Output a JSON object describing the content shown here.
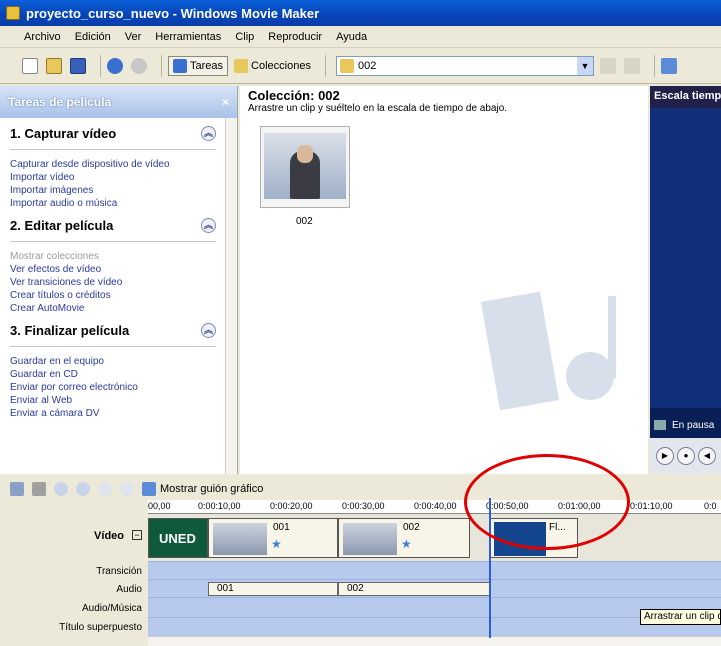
{
  "window": {
    "title": "proyecto_curso_nuevo - Windows Movie Maker"
  },
  "menu": [
    "Archivo",
    "Edición",
    "Ver",
    "Herramientas",
    "Clip",
    "Reproducir",
    "Ayuda"
  ],
  "toolbar": {
    "tasks_label": "Tareas",
    "collections_label": "Colecciones",
    "collection_value": "002"
  },
  "taskpane": {
    "header": "Tareas de película",
    "close": "×",
    "sections": [
      {
        "title": "1. Capturar vídeo",
        "links": [
          "Capturar desde dispositivo de vídeo",
          "Importar vídeo",
          "Importar imágenes",
          "Importar audio o música"
        ]
      },
      {
        "title": "2. Editar película",
        "links": [
          "Mostrar colecciones",
          "Ver efectos de vídeo",
          "Ver transiciones de vídeo",
          "Crear títulos o créditos",
          "Crear AutoMovie"
        ]
      },
      {
        "title": "3. Finalizar película",
        "links": [
          "Guardar en el equipo",
          "Guardar en CD",
          "Enviar por correo electrónico",
          "Enviar al Web",
          "Enviar a cámara DV"
        ]
      }
    ]
  },
  "collection": {
    "title": "Colección: 002",
    "subtitle": "Arrastre un clip y suéltelo en la escala de tiempo de abajo.",
    "clip_label": "002"
  },
  "preview": {
    "header": "Escala tiemp",
    "status": "En pausa"
  },
  "timeline": {
    "storyboard_label": "Mostrar guión gráfico",
    "ruler": [
      "00,00",
      "0:00:10,00",
      "0:00:20,00",
      "0:00:30,00",
      "0:00:40,00",
      "0:00:50,00",
      "0:01:00,00",
      "0:01:10,00",
      "0:0"
    ],
    "tracks": {
      "video": "Vídeo",
      "transition": "Transición",
      "audio": "Audio",
      "audio_music": "Audio/Música",
      "title_overlay": "Título superpuesto"
    },
    "video_clips": [
      "UNED",
      "001",
      "002",
      "Fl..."
    ],
    "audio_clips": [
      "001",
      "002"
    ],
    "tooltip": "Arrastrar un clip d"
  },
  "colors": {
    "accent": "#0a5fd8",
    "highlight": "#e00000",
    "uned_green": "#0e5a3a"
  }
}
